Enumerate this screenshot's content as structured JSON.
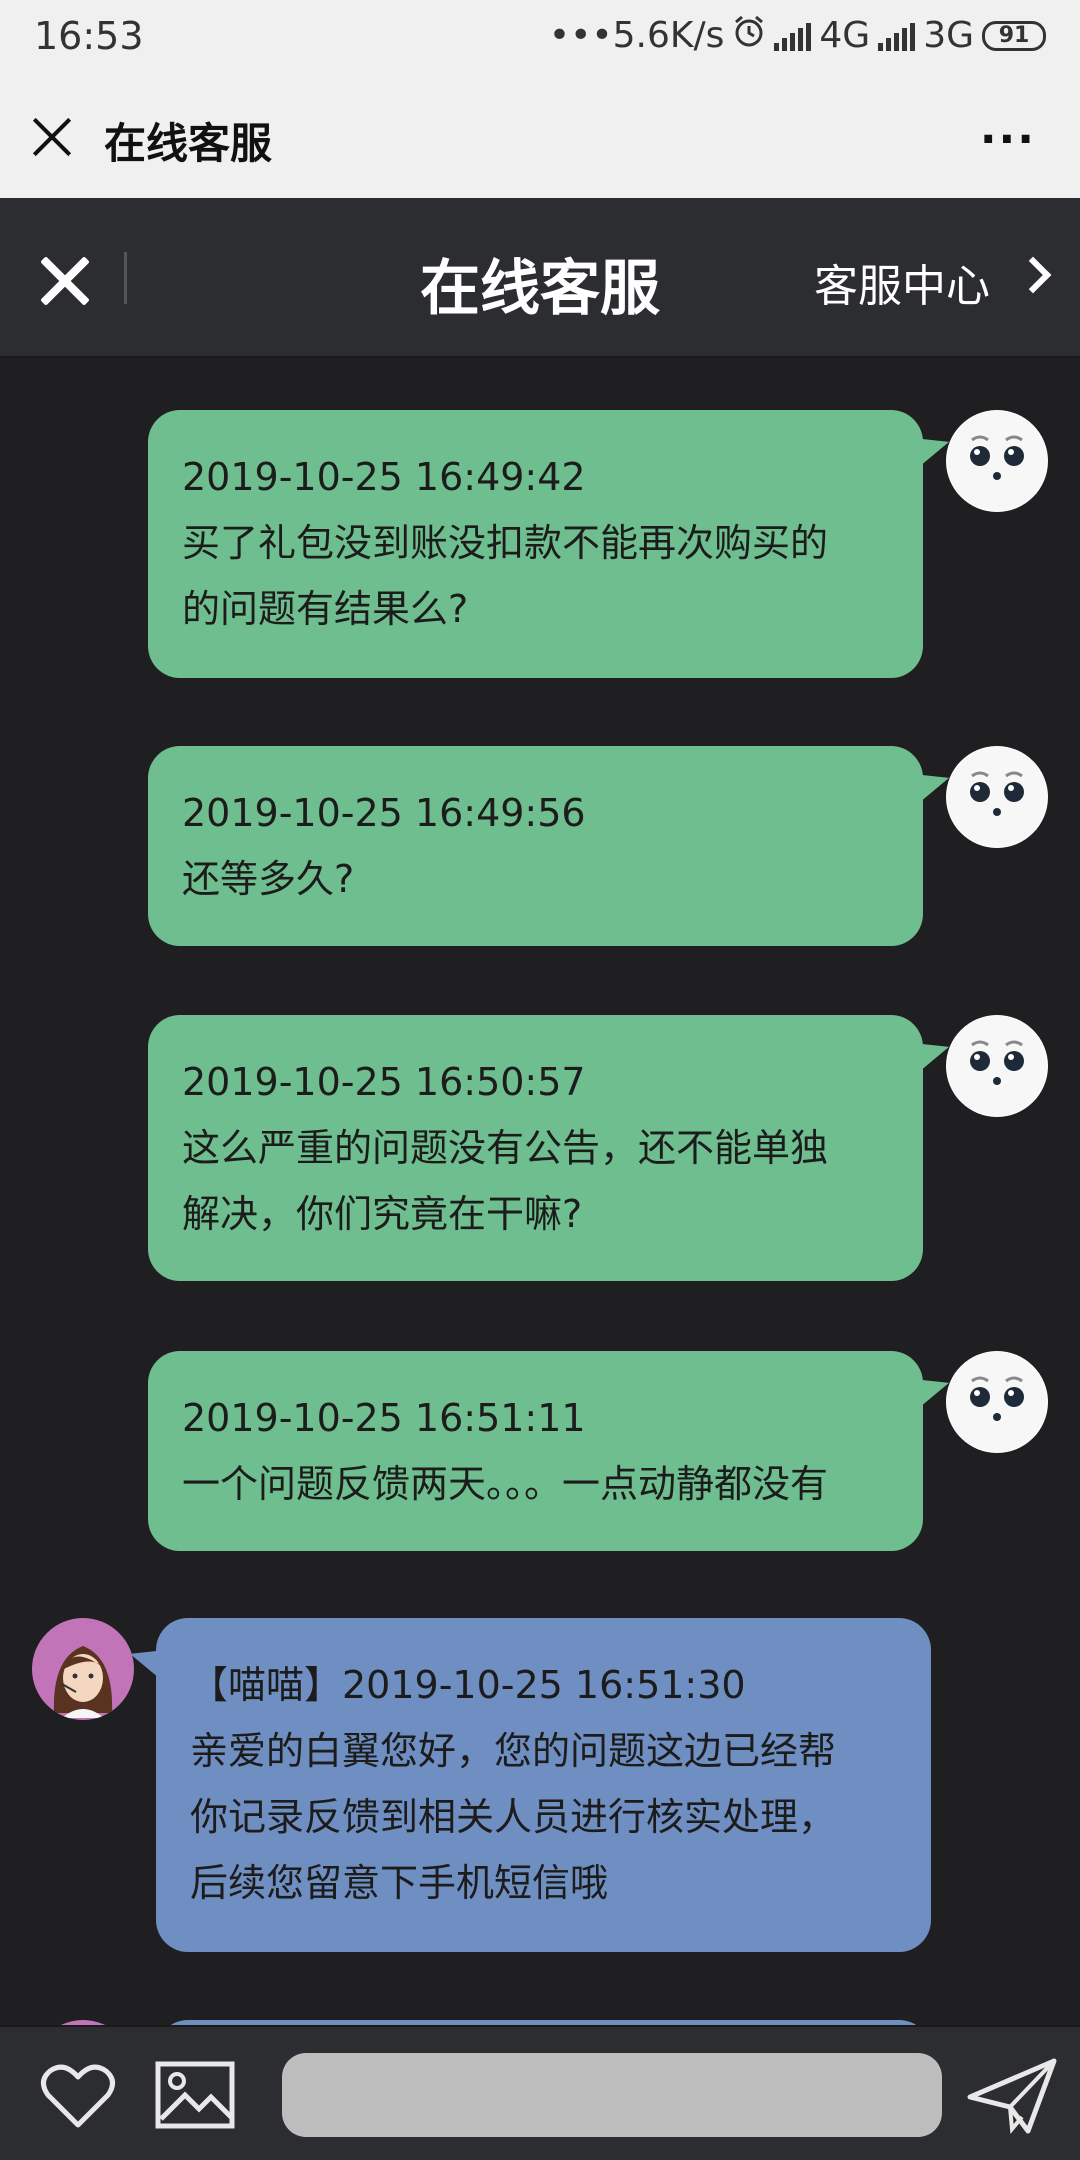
{
  "status_bar": {
    "time": "16:53",
    "net_speed": "•••5.6K/s",
    "alarm_icon": "alarm-icon",
    "network1": "4G",
    "network2": "3G",
    "battery": "91"
  },
  "webview": {
    "title": "在线客服",
    "more": "···"
  },
  "header": {
    "title": "在线客服",
    "service_center": "客服中心"
  },
  "messages": [
    {
      "sender": "user",
      "time": "2019-10-25 16:49:42",
      "lines": [
        "买了礼包没到账没扣款不能再次购买的",
        "的问题有结果么?"
      ]
    },
    {
      "sender": "user",
      "time": "2019-10-25 16:49:56",
      "lines": [
        "还等多久?"
      ]
    },
    {
      "sender": "user",
      "time": "2019-10-25 16:50:57",
      "lines": [
        "这么严重的问题没有公告，还不能单独",
        "解决，你们究竟在干嘛?"
      ]
    },
    {
      "sender": "user",
      "time": "2019-10-25 16:51:11",
      "lines": [
        "一个问题反馈两天。。。一点动静都没有"
      ]
    },
    {
      "sender": "agent",
      "time": "【喵喵】2019-10-25 16:51:30",
      "lines": [
        "亲爱的白翼您好，您的问题这边已经帮",
        "你记录反馈到相关人员进行核实处理，",
        "后续您留意下手机短信哦"
      ]
    }
  ],
  "input": {
    "placeholder": "",
    "icons": [
      "heart-icon",
      "image-icon",
      "send-icon"
    ]
  },
  "colors": {
    "user_bubble": "#6fbe8f",
    "agent_bubble": "#6f8ec1",
    "background": "#1f1f22",
    "header": "#2c2d31"
  }
}
